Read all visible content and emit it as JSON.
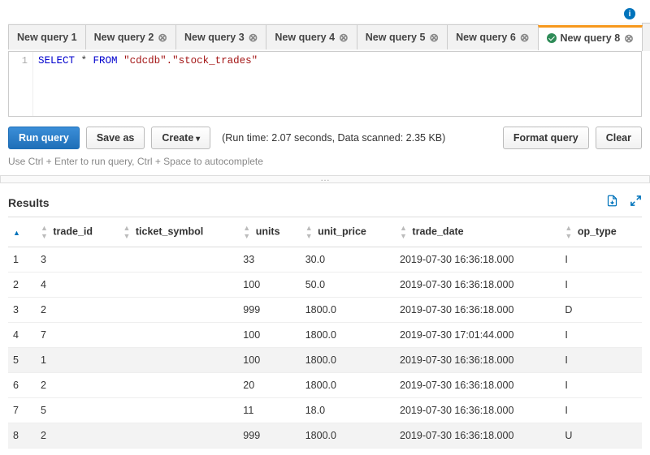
{
  "info_tooltip": "i",
  "tabs": [
    {
      "label": "New query 1",
      "closable": false,
      "active": false
    },
    {
      "label": "New query 2",
      "closable": true,
      "active": false
    },
    {
      "label": "New query 3",
      "closable": true,
      "active": false
    },
    {
      "label": "New query 4",
      "closable": true,
      "active": false
    },
    {
      "label": "New query 5",
      "closable": true,
      "active": false
    },
    {
      "label": "New query 6",
      "closable": true,
      "active": false
    },
    {
      "label": "New query 8",
      "closable": true,
      "active": true,
      "success": true
    }
  ],
  "editor": {
    "line_number": "1",
    "sql_kw1": "SELECT",
    "sql_star": " * ",
    "sql_kw2": "FROM",
    "sql_sp": " ",
    "sql_str": "\"cdcdb\".\"stock_trades\""
  },
  "toolbar": {
    "run": "Run query",
    "save_as": "Save as",
    "create": "Create",
    "run_info": "(Run time: 2.07 seconds, Data scanned: 2.35 KB)",
    "format": "Format query",
    "clear": "Clear"
  },
  "hint": "Use Ctrl + Enter to run query, Ctrl + Space to autocomplete",
  "results": {
    "title": "Results",
    "columns": [
      "",
      "trade_id",
      "ticket_symbol",
      "units",
      "unit_price",
      "trade_date",
      "op_type"
    ],
    "rows": [
      {
        "n": "1",
        "trade_id": "3",
        "ticket_symbol": "",
        "units": "33",
        "unit_price": "30.0",
        "trade_date": "2019-07-30 16:36:18.000",
        "op_type": "I",
        "hl": false
      },
      {
        "n": "2",
        "trade_id": "4",
        "ticket_symbol": "",
        "units": "100",
        "unit_price": "50.0",
        "trade_date": "2019-07-30 16:36:18.000",
        "op_type": "I",
        "hl": false
      },
      {
        "n": "3",
        "trade_id": "2",
        "ticket_symbol": "",
        "units": "999",
        "unit_price": "1800.0",
        "trade_date": "2019-07-30 16:36:18.000",
        "op_type": "D",
        "hl": false
      },
      {
        "n": "4",
        "trade_id": "7",
        "ticket_symbol": "",
        "units": "100",
        "unit_price": "1800.0",
        "trade_date": "2019-07-30 17:01:44.000",
        "op_type": "I",
        "hl": false
      },
      {
        "n": "5",
        "trade_id": "1",
        "ticket_symbol": "",
        "units": "100",
        "unit_price": "1800.0",
        "trade_date": "2019-07-30 16:36:18.000",
        "op_type": "I",
        "hl": true
      },
      {
        "n": "6",
        "trade_id": "2",
        "ticket_symbol": "",
        "units": "20",
        "unit_price": "1800.0",
        "trade_date": "2019-07-30 16:36:18.000",
        "op_type": "I",
        "hl": false
      },
      {
        "n": "7",
        "trade_id": "5",
        "ticket_symbol": "",
        "units": "11",
        "unit_price": "18.0",
        "trade_date": "2019-07-30 16:36:18.000",
        "op_type": "I",
        "hl": false
      },
      {
        "n": "8",
        "trade_id": "2",
        "ticket_symbol": "",
        "units": "999",
        "unit_price": "1800.0",
        "trade_date": "2019-07-30 16:36:18.000",
        "op_type": "U",
        "hl": true
      }
    ]
  }
}
